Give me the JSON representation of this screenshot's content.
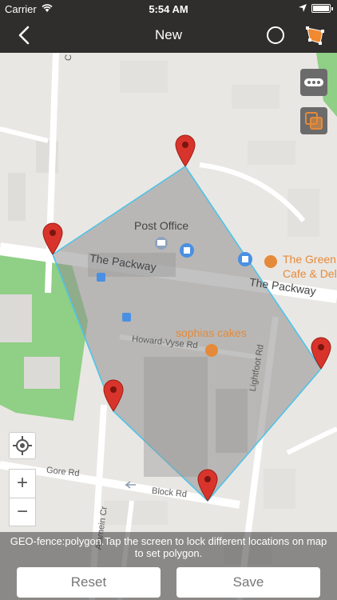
{
  "status": {
    "carrier": "Carrier",
    "time": "5:54 AM"
  },
  "nav": {
    "title": "New"
  },
  "map": {
    "labels": {
      "post_office": "Post Office",
      "the_packway_1": "The Packway",
      "the_packway_2": "The Packway",
      "the_green_1": "The Green",
      "the_green_2": "Cafe & Deli",
      "sophias_cakes": "sophias cakes",
      "howard_vyse": "Howard-Vyse Rd",
      "lightfoot": "Lightfoot Rd",
      "gore": "Gore Rd",
      "block": "Block Rd",
      "alamein": "Alamein Cr",
      "corner_c": "C"
    },
    "colors": {
      "polygon_fill": "#8f8f8f",
      "polygon_stroke": "#4fc3e8",
      "pin": "#d9342b",
      "park": "#8fcf86",
      "poi_orange": "#e58a3a",
      "poi_blue": "#4a90e2"
    },
    "icons": {
      "more": "more-icon",
      "layers": "layers-icon",
      "locate": "locate-icon",
      "zoom_in": "+",
      "zoom_out": "−"
    }
  },
  "bottom": {
    "instruction": "GEO-fence:polygon.Tap the screen to lock different locations on map to set polygon.",
    "reset_label": "Reset",
    "save_label": "Save"
  }
}
